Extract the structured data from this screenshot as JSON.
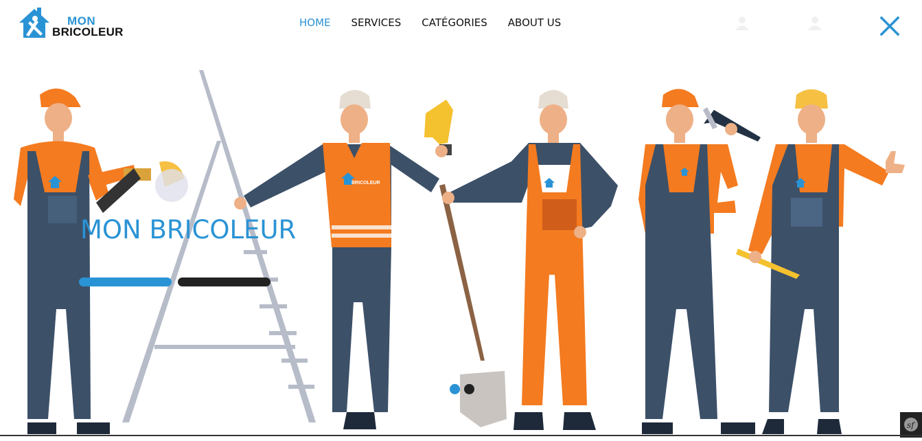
{
  "brand": {
    "line1": "MON",
    "line2": "BRICOLEUR"
  },
  "nav": {
    "items": [
      {
        "label": "HOME"
      },
      {
        "label": "SERVICES"
      },
      {
        "label": "CATÉGORIES"
      },
      {
        "label": "ABOUT US"
      }
    ],
    "active_item": "HOME"
  },
  "hero": {
    "title": "MON BRICOLEUR",
    "vest_logo": "BRICOLEUR",
    "slides_count": 2,
    "active_slide": 1
  },
  "icons": {
    "logo": "house-tools-icon",
    "user_1": "user-icon",
    "user_2": "user-icon",
    "close": "close-icon",
    "framework": "symfony-icon"
  },
  "colors": {
    "accent": "#2a93d5",
    "dark": "#222222",
    "orange": "#f47b20",
    "navy": "#3c5068"
  }
}
